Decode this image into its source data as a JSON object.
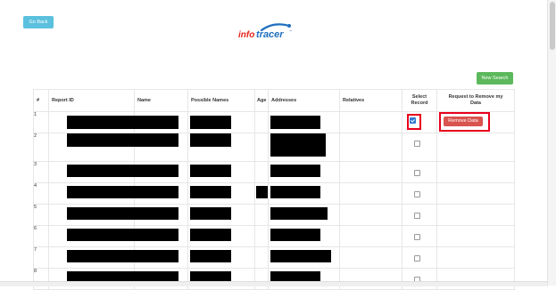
{
  "header": {
    "back_label": "Go Back",
    "logo_text_left": "info",
    "logo_text_right": "tracer",
    "tm": "™"
  },
  "toolbar": {
    "new_search_label": "New Search"
  },
  "table": {
    "columns": {
      "num": "#",
      "report_id": "Report ID",
      "name": "Name",
      "possible_names": "Possible Names",
      "age": "Age",
      "addresses": "Addresses",
      "relatives": "Relatives",
      "select_line1": "Select",
      "select_line2": "Record",
      "request_line1": "Request to Remove my",
      "request_line2": "Data"
    },
    "rows": [
      {
        "num": "1",
        "selected": true,
        "action_label": "Remove Data"
      },
      {
        "num": "2",
        "selected": false
      },
      {
        "num": "3",
        "selected": false
      },
      {
        "num": "4",
        "selected": false
      },
      {
        "num": "5",
        "selected": false
      },
      {
        "num": "6",
        "selected": false
      },
      {
        "num": "7",
        "selected": false
      },
      {
        "num": "8",
        "selected": false
      }
    ]
  },
  "colors": {
    "back_button": "#5bc0de",
    "new_search_button": "#5cb85c",
    "remove_button": "#d9534f",
    "highlight": "#e8001c",
    "logo_red": "#e4231b",
    "logo_blue": "#1f6fbf"
  }
}
